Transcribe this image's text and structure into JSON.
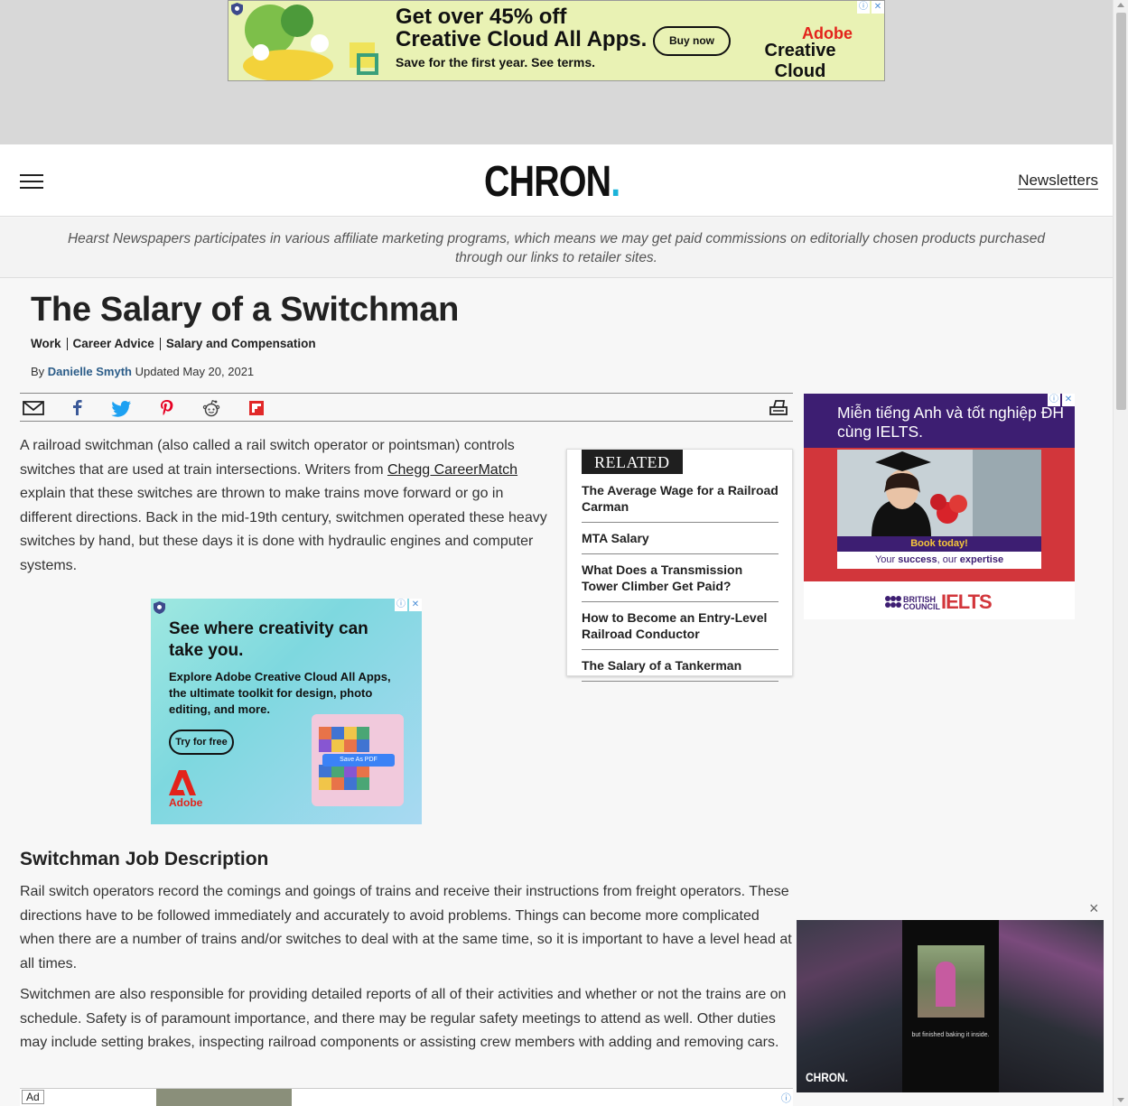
{
  "top_ad": {
    "headline_line1": "Get over 45% off",
    "headline_line2": "Creative Cloud All Apps.",
    "sub": "Save for the first year. See terms.",
    "button": "Buy now",
    "brand_line1": "Adobe",
    "brand_line2": "Creative Cloud"
  },
  "header": {
    "logo_text": "CHRON",
    "logo_dot": ".",
    "newsletters": "Newsletters",
    "logo_accent_color": "#1bb3d9"
  },
  "affiliate_notice": "Hearst Newspapers participates in various affiliate marketing programs, which means we may get paid commissions on editorially chosen products purchased through our links to retailer sites.",
  "article": {
    "title": "The Salary of a Switchman",
    "categories": [
      "Work",
      "Career Advice",
      "Salary and Compensation"
    ],
    "by_label": "By",
    "author": "Danielle Smyth",
    "updated": "Updated May 20, 2021",
    "p1_before": "A railroad switchman (also called a rail switch operator or pointsman) controls switches that are used at train intersections. Writers from ",
    "p1_link": "Chegg CareerMatch",
    "p1_after": " explain that these switches are thrown to make trains move forward or go in different directions. Back in the mid-19th century, switchmen operated these heavy switches by hand, but these days it is done with hydraulic engines and computer systems.",
    "h2": "Switchman Job Description",
    "p2": "Rail switch operators record the comings and goings of trains and receive their instructions from freight operators. These directions have to be followed immediately and accurately to avoid problems. Things can become more complicated when there are a number of trains and/or switches to deal with at the same time, so it is important to have a level head at all times.",
    "p3": "Switchmen are also responsible for providing detailed reports of all of their activities and whether or not the trains are on schedule. Safety is of paramount importance, and there may be regular safety meetings to attend as well. Other duties may include setting brakes, inspecting railroad components or assisting crew members with adding and removing cars."
  },
  "share_icons": [
    "email-icon",
    "facebook-icon",
    "twitter-icon",
    "pinterest-icon",
    "reddit-icon",
    "flipboard-icon",
    "print-icon"
  ],
  "related": {
    "label": "RELATED",
    "items": [
      "The Average Wage for a Railroad Carman",
      "MTA Salary",
      "What Does a Transmission Tower Climber Get Paid?",
      "How to Become an Entry-Level Railroad Conductor",
      "The Salary of a Tankerman"
    ]
  },
  "mid_ad": {
    "headline": "See where creativity can take you.",
    "desc": "Explore Adobe Creative Cloud All Apps, the ultimate toolkit for design, photo editing, and more.",
    "button": "Try for free",
    "brand": "Adobe",
    "card_button": "Save As PDF"
  },
  "side_ad": {
    "headline": "Miễn tiếng Anh và tốt nghiệp ĐH cùng IELTS.",
    "book": "Book today!",
    "tagline_pre": "Your ",
    "tagline_bold1": "success",
    "tagline_mid": ", our ",
    "tagline_bold2": "expertise",
    "bc_line1": "BRITISH",
    "bc_line2": "COUNCIL",
    "ielts": "IELTS"
  },
  "video": {
    "caption": "but finished baking it inside.",
    "logo": "CHRON.",
    "close": "×"
  },
  "bottom_ad": {
    "label": "Ad"
  },
  "ad_controls": {
    "info": "ⓘ",
    "close": "✕"
  }
}
